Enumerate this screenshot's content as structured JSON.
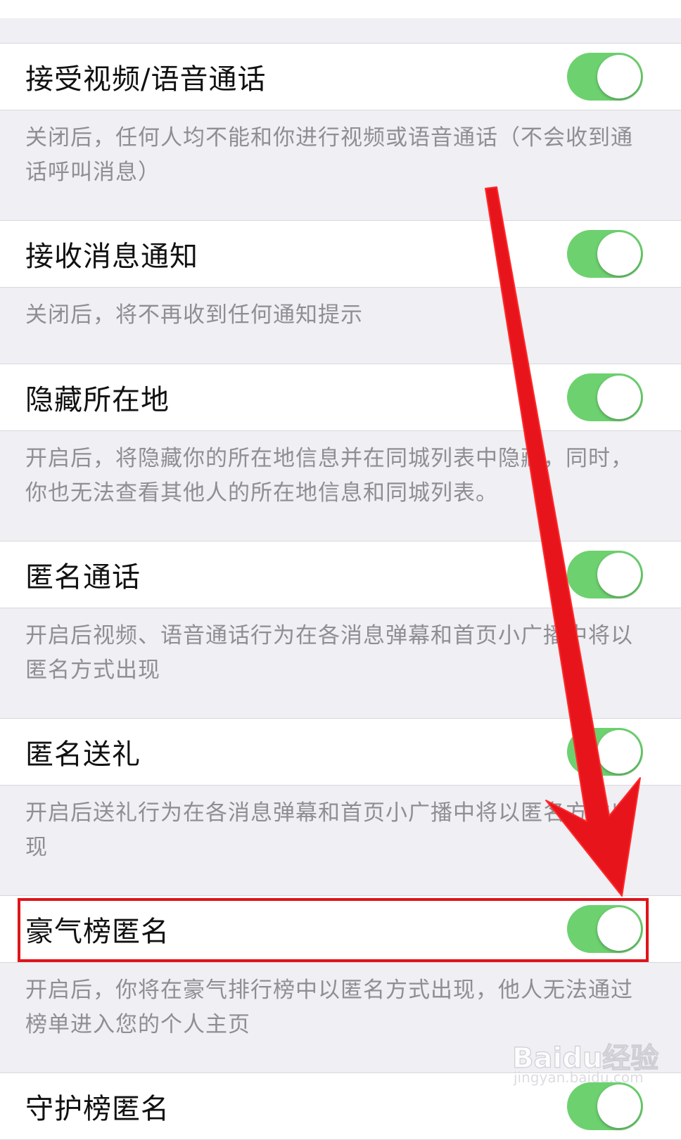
{
  "settings": [
    {
      "label": "接受视频/语音通话",
      "on": true,
      "desc": "关闭后，任何人均不能和你进行视频或语音通话（不会收到通话呼叫消息）"
    },
    {
      "label": "接收消息通知",
      "on": true,
      "desc": "关闭后，将不再收到任何通知提示"
    },
    {
      "label": "隐藏所在地",
      "on": true,
      "desc": "开启后，将隐藏你的所在地信息并在同城列表中隐藏，同时，你也无法查看其他人的所在地信息和同城列表。"
    },
    {
      "label": "匿名通话",
      "on": true,
      "desc": "开启后视频、语音通话行为在各消息弹幕和首页小广播中将以匿名方式出现"
    },
    {
      "label": "匿名送礼",
      "on": true,
      "desc": "开启后送礼行为在各消息弹幕和首页小广播中将以匿名方式出现"
    },
    {
      "label": "豪气榜匿名",
      "on": true,
      "desc": "开启后，你将在豪气排行榜中以匿名方式出现，他人无法通过榜单进入您的个人主页"
    },
    {
      "label": "守护榜匿名",
      "on": true
    }
  ],
  "watermark": {
    "logo": "Baidu经验",
    "url": "jingyan.baidu.com"
  },
  "colors": {
    "toggle_on": "#6dd16f",
    "annotation": "#e0141a",
    "background": "#efeff4"
  }
}
